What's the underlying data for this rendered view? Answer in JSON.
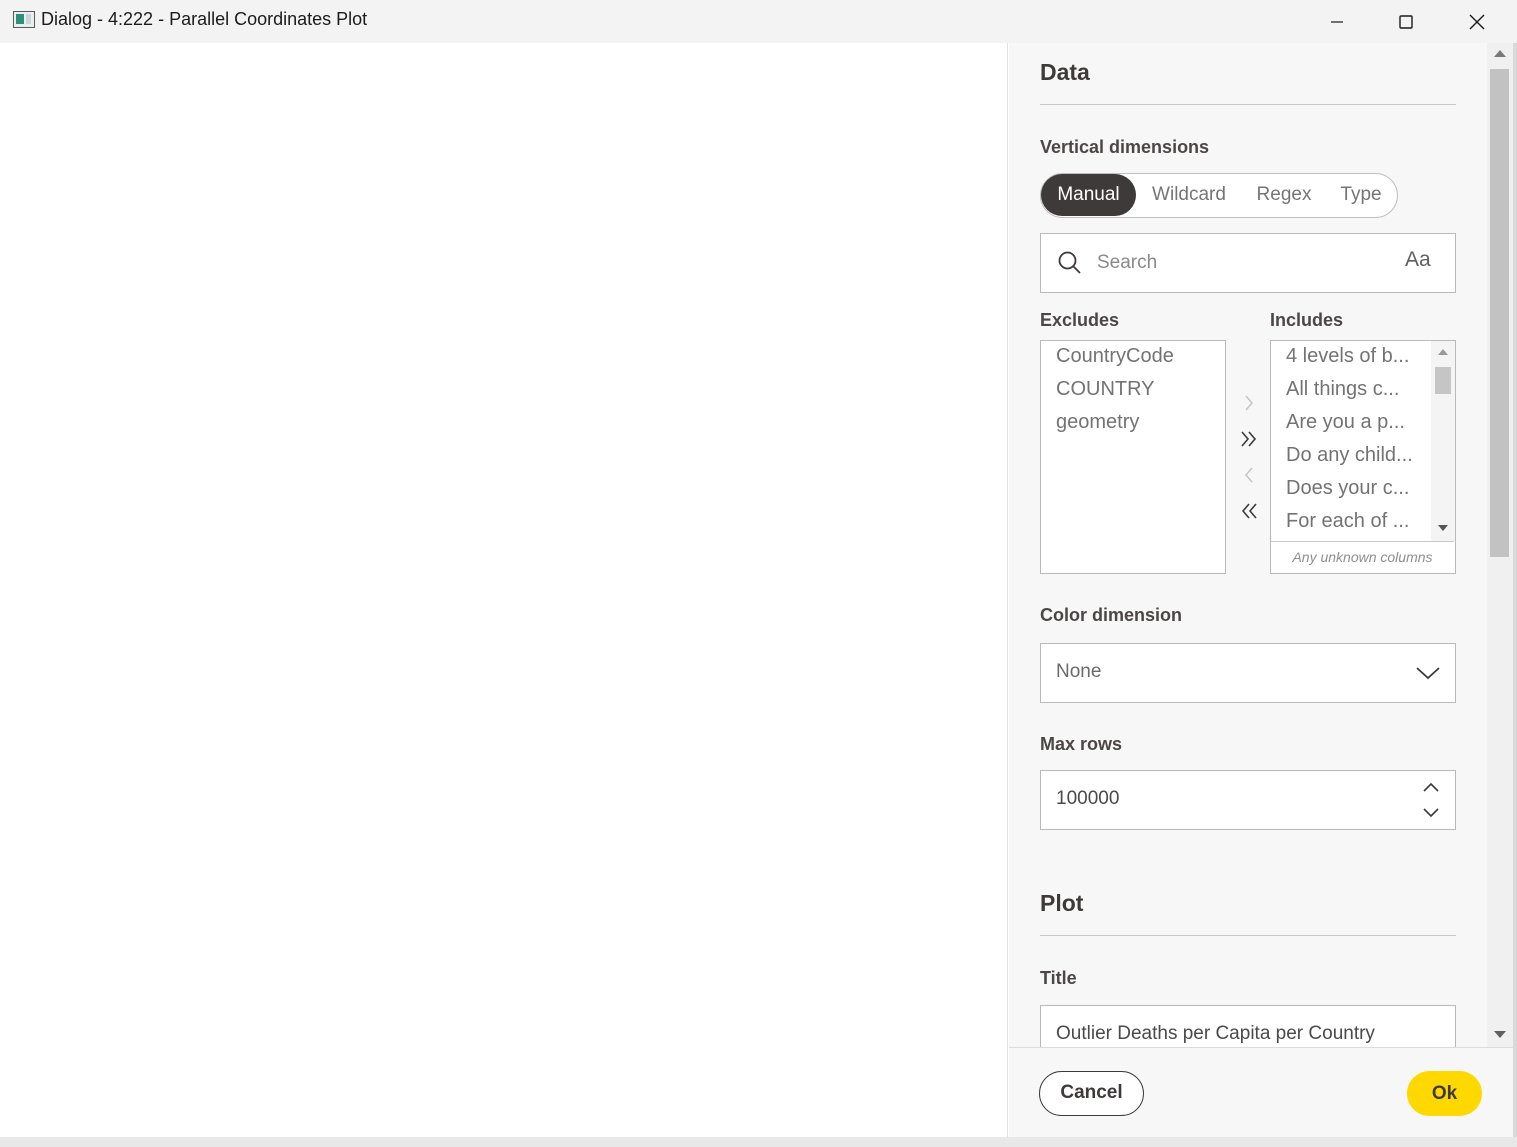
{
  "window": {
    "title": "Dialog - 4:222 - Parallel Coordinates Plot"
  },
  "data_section": {
    "heading": "Data",
    "vertical_dimensions": {
      "label": "Vertical dimensions",
      "modes": [
        "Manual",
        "Wildcard",
        "Regex",
        "Type"
      ],
      "active_mode": "Manual"
    },
    "search": {
      "placeholder": "Search",
      "case_toggle": "Aa"
    },
    "excludes": {
      "label": "Excludes",
      "items": [
        "CountryCode",
        "COUNTRY",
        "geometry"
      ]
    },
    "includes": {
      "label": "Includes",
      "items": [
        "4 levels of b...",
        "All things c...",
        "Are you a p...",
        "Do any child...",
        "Does your c...",
        "For each of ..."
      ],
      "unknown_columns": "Any unknown columns"
    },
    "color_dimension": {
      "label": "Color dimension",
      "value": "None"
    },
    "max_rows": {
      "label": "Max rows",
      "value": "100000"
    }
  },
  "plot_section": {
    "heading": "Plot",
    "title_label": "Title",
    "title_value": "Outlier Deaths per Capita per Country"
  },
  "footer": {
    "cancel": "Cancel",
    "ok": "Ok"
  },
  "colors": {
    "accent_yellow": "#ffd800",
    "dark": "#3e3a39",
    "panel_bg": "#f7f7f7"
  }
}
